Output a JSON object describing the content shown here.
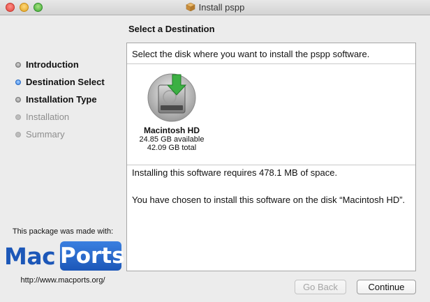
{
  "window": {
    "title": "Install pspp"
  },
  "sidebar": {
    "steps": [
      {
        "label": "Introduction",
        "state": "done"
      },
      {
        "label": "Destination Select",
        "state": "active"
      },
      {
        "label": "Installation Type",
        "state": "done"
      },
      {
        "label": "Installation",
        "state": "pending"
      },
      {
        "label": "Summary",
        "state": "pending"
      }
    ],
    "made_with": "This package was made with:",
    "logo_left": "Mac",
    "logo_right": "Ports",
    "logo_url": "http://www.macports.org/"
  },
  "main": {
    "heading": "Select a Destination",
    "prompt": "Select the disk where you want to install the pspp software.",
    "disk": {
      "name": "Macintosh HD",
      "available": "24.85 GB available",
      "total": "42.09 GB total"
    },
    "requirement": "Installing this software requires 478.1 MB of space.",
    "chosen": "You have chosen to install this software on the disk “Macintosh HD”."
  },
  "buttons": {
    "back": "Go Back",
    "continue": "Continue"
  },
  "colors": {
    "accent": "#3b82e6",
    "macports_blue": "#1c57b8",
    "disk_arrow": "#3cb043"
  },
  "icons": {
    "title": "package-icon",
    "disk": "hard-disk-icon"
  }
}
